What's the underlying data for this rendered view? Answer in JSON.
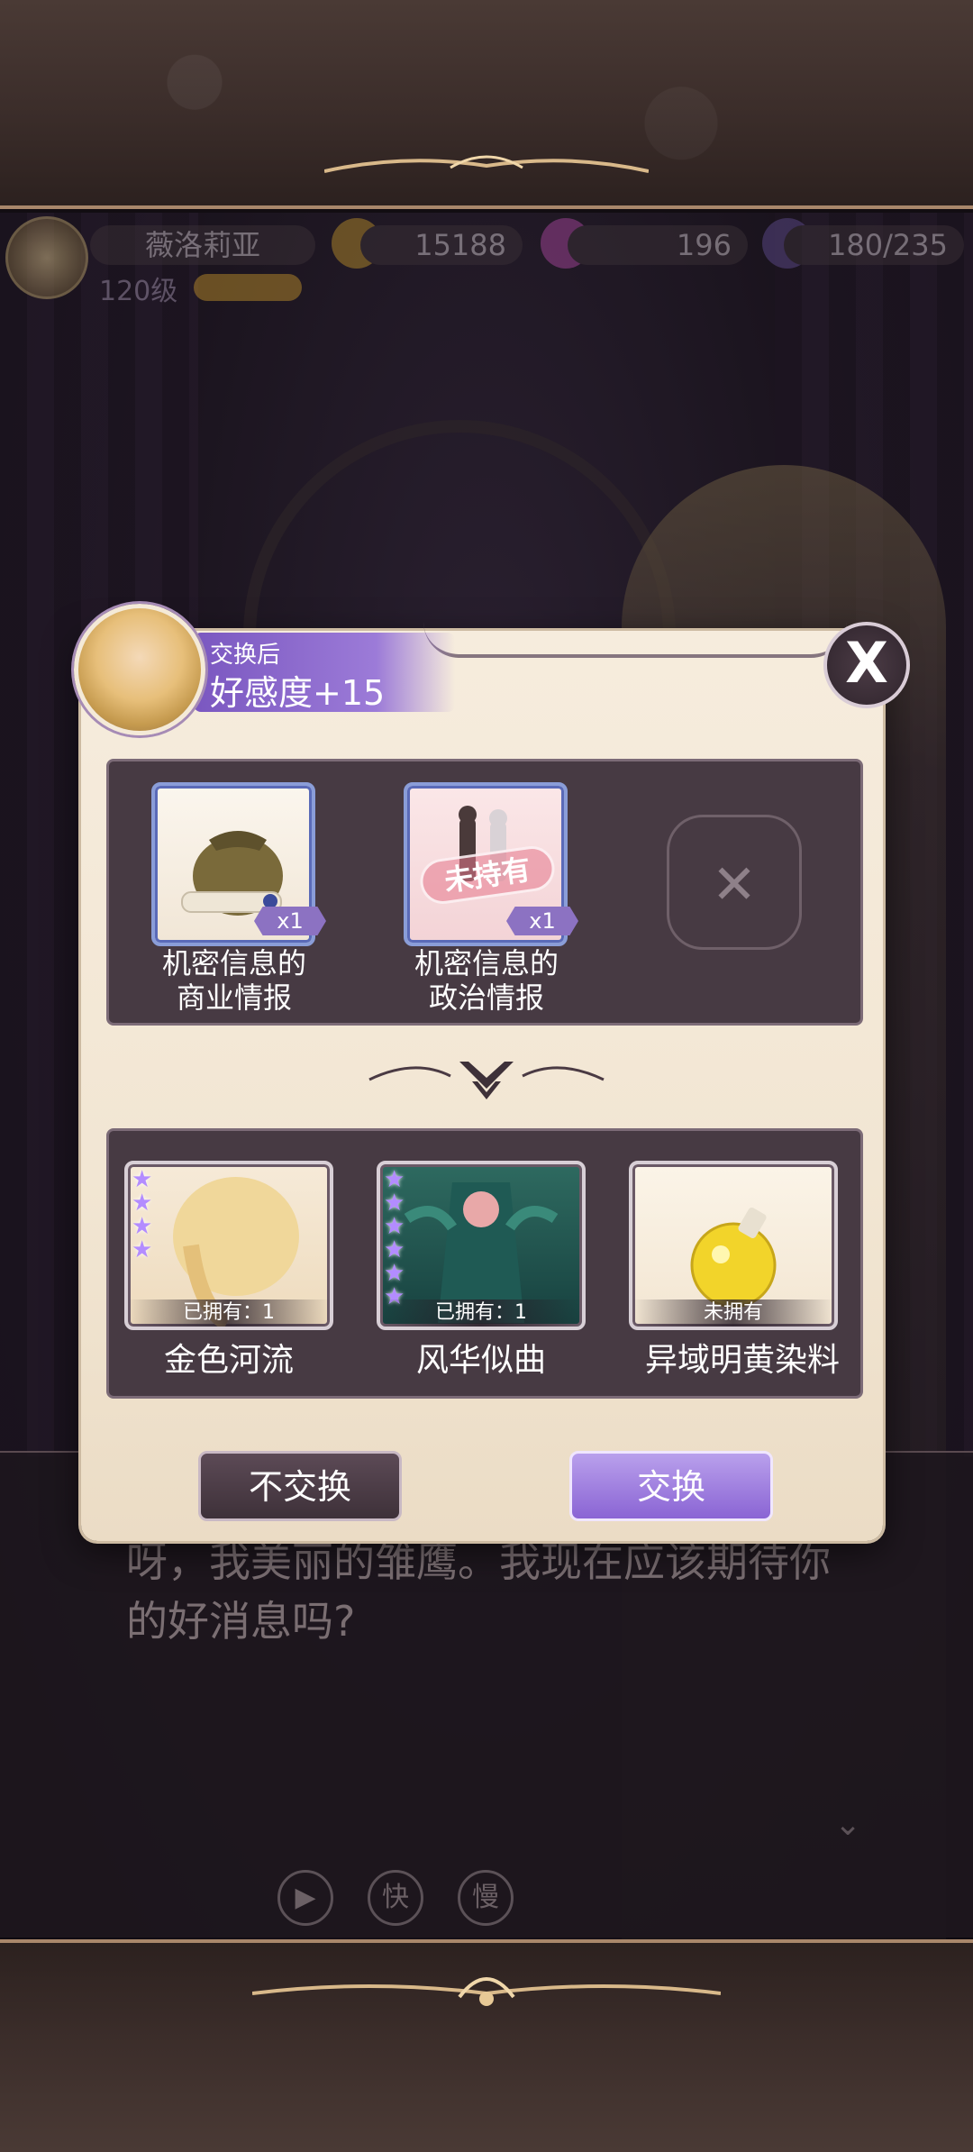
{
  "hud": {
    "player_name": "薇洛莉亚",
    "level": "120级",
    "gold": "15188",
    "gems": "196",
    "stamina": "180/235"
  },
  "dialog": {
    "text": "呀，我美丽的雏鹰。我现在应该期待你的好消息吗?",
    "controls": [
      "快",
      "慢"
    ]
  },
  "modal": {
    "affinity_caption": "交换后",
    "affinity_value": "好感度+15",
    "close_symbol": "X",
    "input_items": [
      {
        "label_line1": "机密信息的",
        "label_line2": "商业情报",
        "qty": "x1",
        "stamp": ""
      },
      {
        "label_line1": "机密信息的",
        "label_line2": "政治情报",
        "qty": "x1",
        "stamp": "未持有"
      }
    ],
    "reward_items": [
      {
        "label": "金色河流",
        "owned": "已拥有：1",
        "stars": "★★★★"
      },
      {
        "label": "风华似曲",
        "owned": "已拥有：1",
        "stars": "★★★★★★"
      },
      {
        "label": "异域明黄染料",
        "owned": "未拥有",
        "stars": ""
      }
    ],
    "decline_label": "不交换",
    "confirm_label": "交换"
  },
  "colors": {
    "accent_purple": "#8a64d4",
    "panel_dark": "#473a43",
    "parchment": "#f2e6d3"
  }
}
